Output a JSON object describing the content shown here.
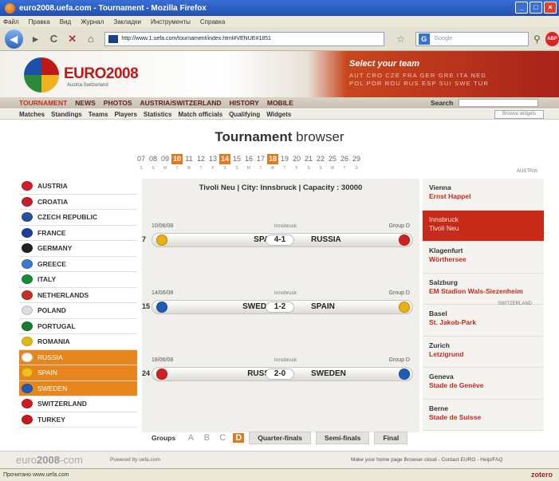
{
  "window": {
    "title": "euro2008.uefa.com - Tournament - Mozilla Firefox"
  },
  "menu": [
    "Файл",
    "Правка",
    "Вид",
    "Журнал",
    "Закладки",
    "Инструменты",
    "Справка"
  ],
  "address": {
    "url": "http://www.1.uefa.com/tournament/index.html#VENUE#1851",
    "search_placeholder": "Google"
  },
  "header": {
    "logo": "EURO2008",
    "logo_sub": "Austria-Switzerland",
    "select_team": "Select your team",
    "teams_row1": "AUT CRO CZE FRA GER GRE ITA NED",
    "teams_row2": "POL POR ROU RUS ESP SUI SWE TUR"
  },
  "nav": {
    "items": [
      "TOURNAMENT",
      "NEWS",
      "PHOTOS",
      "AUSTRIA/SWITZERLAND",
      "HISTORY",
      "MOBILE"
    ],
    "search_label": "Search"
  },
  "subnav": {
    "items": [
      "Matches",
      "Standings",
      "Teams",
      "Players",
      "Statistics",
      "Match officials",
      "Qualifying",
      "Widgets"
    ],
    "widget_button": "Browse widgets"
  },
  "page": {
    "title_bold": "Tournament",
    "title_rest": " browser"
  },
  "dates": [
    {
      "n": "07",
      "d": "S",
      "on": false
    },
    {
      "n": "08",
      "d": "S",
      "on": false
    },
    {
      "n": "09",
      "d": "M",
      "on": false
    },
    {
      "n": "10",
      "d": "T",
      "on": true
    },
    {
      "n": "11",
      "d": "W",
      "on": false
    },
    {
      "n": "12",
      "d": "T",
      "on": false
    },
    {
      "n": "13",
      "d": "F",
      "on": false
    },
    {
      "n": "14",
      "d": "S",
      "on": true
    },
    {
      "n": "15",
      "d": "S",
      "on": false
    },
    {
      "n": "16",
      "d": "M",
      "on": false
    },
    {
      "n": "17",
      "d": "T",
      "on": false
    },
    {
      "n": "18",
      "d": "W",
      "on": true
    },
    {
      "n": "19",
      "d": "T",
      "on": false
    },
    {
      "n": "20",
      "d": "F",
      "on": false
    },
    {
      "n": "21",
      "d": "S",
      "on": false
    },
    {
      "n": "22",
      "d": "S",
      "on": false
    },
    {
      "n": "25",
      "d": "W",
      "on": false
    },
    {
      "n": "26",
      "d": "T",
      "on": false
    },
    {
      "n": "29",
      "d": "S",
      "on": false
    }
  ],
  "labels": {
    "austria": "AUSTRIA",
    "switzerland": "SWITZERLAND"
  },
  "teams": [
    {
      "name": "AUSTRIA",
      "color": "#d0202c",
      "sel": false
    },
    {
      "name": "CROATIA",
      "color": "#c4202a",
      "sel": false
    },
    {
      "name": "CZECH REPUBLIC",
      "color": "#2a4fa0",
      "sel": false
    },
    {
      "name": "FRANCE",
      "color": "#1c3f9c",
      "sel": false
    },
    {
      "name": "GERMANY",
      "color": "#222222",
      "sel": false
    },
    {
      "name": "GREECE",
      "color": "#3a7ad0",
      "sel": false
    },
    {
      "name": "ITALY",
      "color": "#1a8a3a",
      "sel": false
    },
    {
      "name": "NETHERLANDS",
      "color": "#c43028",
      "sel": false
    },
    {
      "name": "POLAND",
      "color": "#dcdcdc",
      "sel": false
    },
    {
      "name": "PORTUGAL",
      "color": "#1e7a30",
      "sel": false
    },
    {
      "name": "ROMANIA",
      "color": "#e0b818",
      "sel": false
    },
    {
      "name": "RUSSIA",
      "color": "#ffffff",
      "sel": true
    },
    {
      "name": "SPAIN",
      "color": "#f0c020",
      "sel": true
    },
    {
      "name": "SWEDEN",
      "color": "#1e5cb8",
      "sel": true
    },
    {
      "name": "SWITZERLAND",
      "color": "#d41c1c",
      "sel": false
    },
    {
      "name": "TURKEY",
      "color": "#c8181c",
      "sel": false
    }
  ],
  "venue_head": "Tivoli Neu | City: Innsbruck | Capacity : 30000",
  "matches": [
    {
      "date": "10/06/08",
      "city": "Innsbruck",
      "group": "Group D",
      "num": "7",
      "home": "SPAIN",
      "score": "4-1",
      "away": "RUSSIA",
      "home_color": "#e8b010",
      "away_color": "#d02020"
    },
    {
      "date": "14/06/08",
      "city": "Innsbruck",
      "group": "Group D",
      "num": "15",
      "home": "SWEDEN",
      "score": "1-2",
      "away": "SPAIN",
      "home_color": "#1e5cb8",
      "away_color": "#e8b010"
    },
    {
      "date": "18/06/08",
      "city": "Innsbruck",
      "group": "Group D",
      "num": "24",
      "home": "RUSSIA",
      "score": "2-0",
      "away": "SWEDEN",
      "home_color": "#d02020",
      "away_color": "#1e5cb8"
    }
  ],
  "venues": [
    {
      "city": "Vienna",
      "stadium": "Ernst Happel",
      "sel": false
    },
    {
      "city": "Innsbruck",
      "stadium": "Tivoli Neu",
      "sel": true
    },
    {
      "city": "Klagenfurt",
      "stadium": "Wörthersee",
      "sel": false
    },
    {
      "city": "Salzburg",
      "stadium": "EM Stadion Wals-Siezenheim",
      "sel": false
    },
    {
      "city": "Basel",
      "stadium": "St. Jakob-Park",
      "sel": false
    },
    {
      "city": "Zurich",
      "stadium": "Letzigrund",
      "sel": false
    },
    {
      "city": "Geneva",
      "stadium": "Stade de Genève",
      "sel": false
    },
    {
      "city": "Berne",
      "stadium": "Stade de Suisse",
      "sel": false
    }
  ],
  "groups": {
    "label": "Groups",
    "letters": [
      {
        "l": "A",
        "on": false
      },
      {
        "l": "B",
        "on": false
      },
      {
        "l": "C",
        "on": false
      },
      {
        "l": "D",
        "on": true
      }
    ],
    "buttons": [
      "Quarter-finals",
      "Semi-finals",
      "Final"
    ]
  },
  "footer": {
    "logo_a": "euro",
    "logo_b": "2008",
    "logo_c": "-com",
    "powered": "Powered by uefa.com",
    "links": "Make your home page  Browser cloud - Contact EURO - Help/FAQ"
  },
  "status": {
    "text": "Прочитано www.uefa.com",
    "zotero": "zotero"
  }
}
